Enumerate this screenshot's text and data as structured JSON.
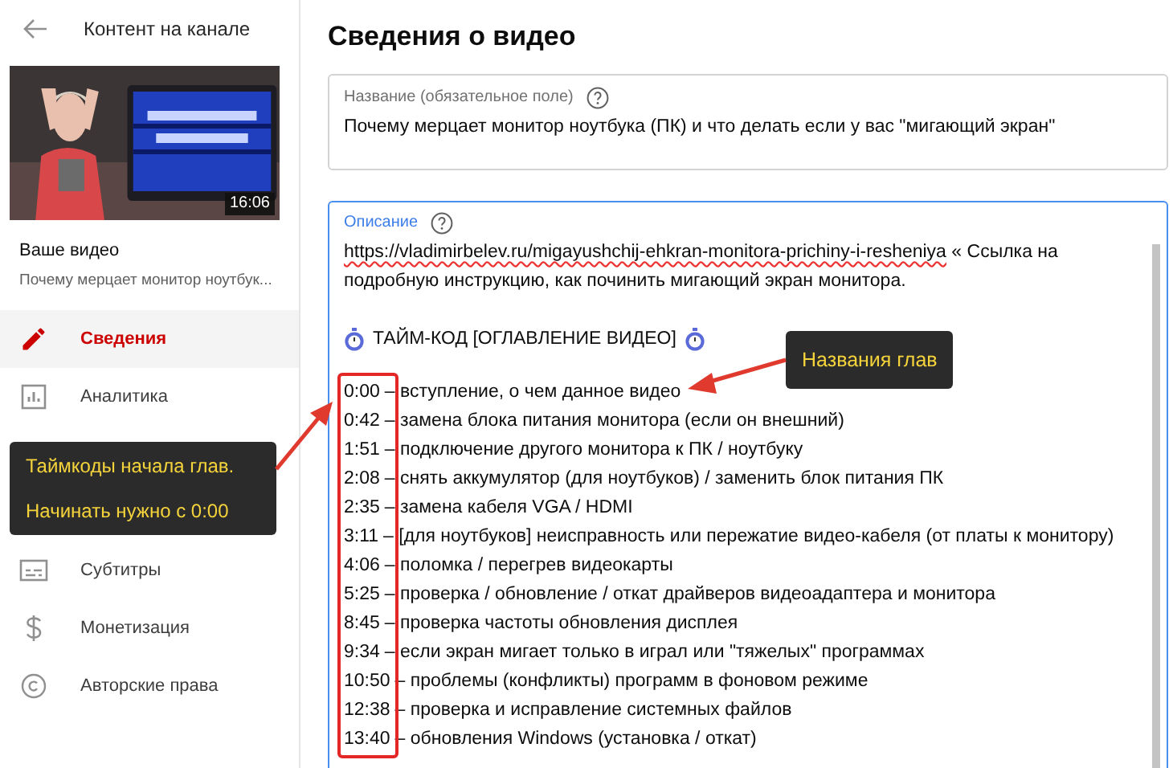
{
  "sidebar": {
    "back_label": "Контент на канале",
    "video": {
      "duration": "16:06",
      "heading": "Ваше видео",
      "title": "Почему мерцает монитор ноутбук..."
    },
    "items": [
      {
        "label": "Сведения",
        "kind": "pencil",
        "selected": true
      },
      {
        "label": "Аналитика",
        "kind": "chart",
        "selected": false
      },
      {
        "kind": "hidden"
      },
      {
        "label": "Субтитры",
        "kind": "subtitles",
        "selected": false
      },
      {
        "label": "Монетизация",
        "kind": "dollar",
        "selected": false
      },
      {
        "label": "Авторские права",
        "kind": "copyright",
        "selected": false
      }
    ]
  },
  "page_title": "Сведения о видео",
  "title_field": {
    "label": "Название (обязательное поле)",
    "value": "Почему мерцает монитор ноутбука (ПК) и что делать если у вас \"мигающий экран\""
  },
  "description_field": {
    "label": "Описание",
    "url": "https://vladimirbelev.ru/migayushchij-ehkran-monitora-prichiny-i-resheniya",
    "intro": "« Ссылка на подробную инструкцию, как починить мигающий экран монитора.",
    "header": "ТАЙМ-КОД [ОГЛАВЛЕНИЕ ВИДЕО]",
    "chapters": [
      {
        "time": "0:00",
        "title": "– вступление, о чем данное видео"
      },
      {
        "time": "0:42",
        "title": "– замена блока питания монитора (если он внешний)"
      },
      {
        "time": "1:51",
        "title": "– подключение другого монитора к ПК / ноутбуку"
      },
      {
        "time": "2:08",
        "title": "– снять аккумулятор (для ноутбуков) / заменить блок питания ПК"
      },
      {
        "time": "2:35",
        "title": "– замена кабеля VGA / HDMI"
      },
      {
        "time": "3:11",
        "title": "– [для ноутбуков] неисправность или пережатие видео-кабеля (от платы к монитору)"
      },
      {
        "time": "4:06",
        "title": "– поломка / перегрев видеокарты"
      },
      {
        "time": "5:25",
        "title": "– проверка / обновление / откат драйверов видеоадаптера и монитора"
      },
      {
        "time": "8:45",
        "title": "– проверка частоты обновления дисплея"
      },
      {
        "time": "9:34",
        "title": "– если экран мигает только в играл или \"тяжелых\" программах"
      },
      {
        "time": "10:50",
        "title": "– проблемы (конфликты) программ в фоновом режиме"
      },
      {
        "time": "12:38",
        "title": "– проверка и исправление системных файлов"
      },
      {
        "time": "13:40",
        "title": "– обновления Windows (установка / откат)"
      }
    ]
  },
  "callouts": [
    {
      "lines": [
        "Таймкоды начала глав.",
        "Начинать нужно с 0:00"
      ]
    },
    {
      "lines": [
        "Названия глав"
      ]
    }
  ]
}
